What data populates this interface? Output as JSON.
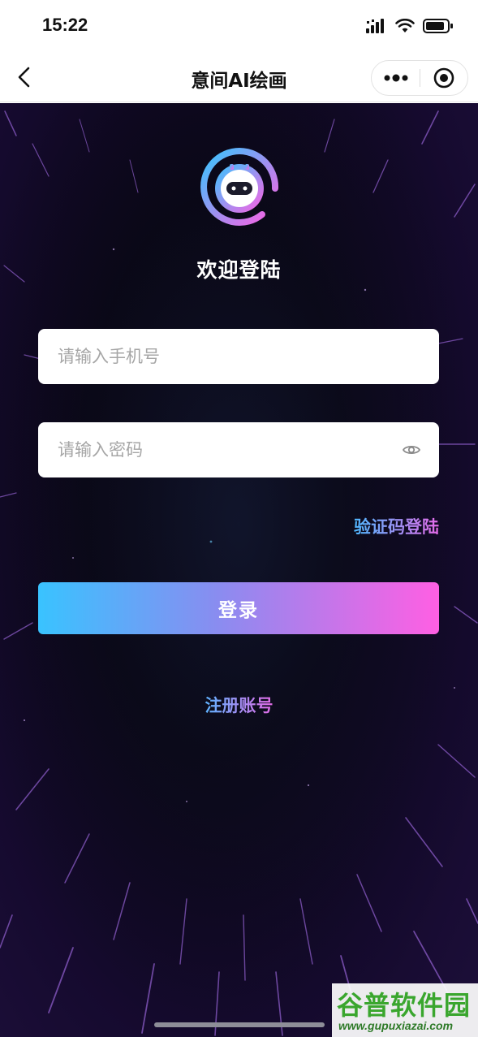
{
  "status_bar": {
    "time": "15:22",
    "icons": [
      "signal-icon",
      "wifi-icon",
      "battery-icon"
    ]
  },
  "nav": {
    "title": "意间AI绘画",
    "back_icon": "chevron-left-icon",
    "more_icon": "more-dots-icon",
    "close_icon": "target-close-icon"
  },
  "login": {
    "welcome": "欢迎登陆",
    "phone_placeholder": "请输入手机号",
    "phone_value": "",
    "password_placeholder": "请输入密码",
    "password_value": "",
    "eye_icon": "eye-icon",
    "sms_login": "验证码登陆",
    "submit": "登录",
    "register": "注册账号"
  },
  "watermark": {
    "main": "谷普软件园",
    "url": "www.gupuxiazai.com"
  },
  "colors": {
    "gradient_start": "#39c3ff",
    "gradient_end": "#ff5fe3",
    "background": "#0a0716"
  }
}
